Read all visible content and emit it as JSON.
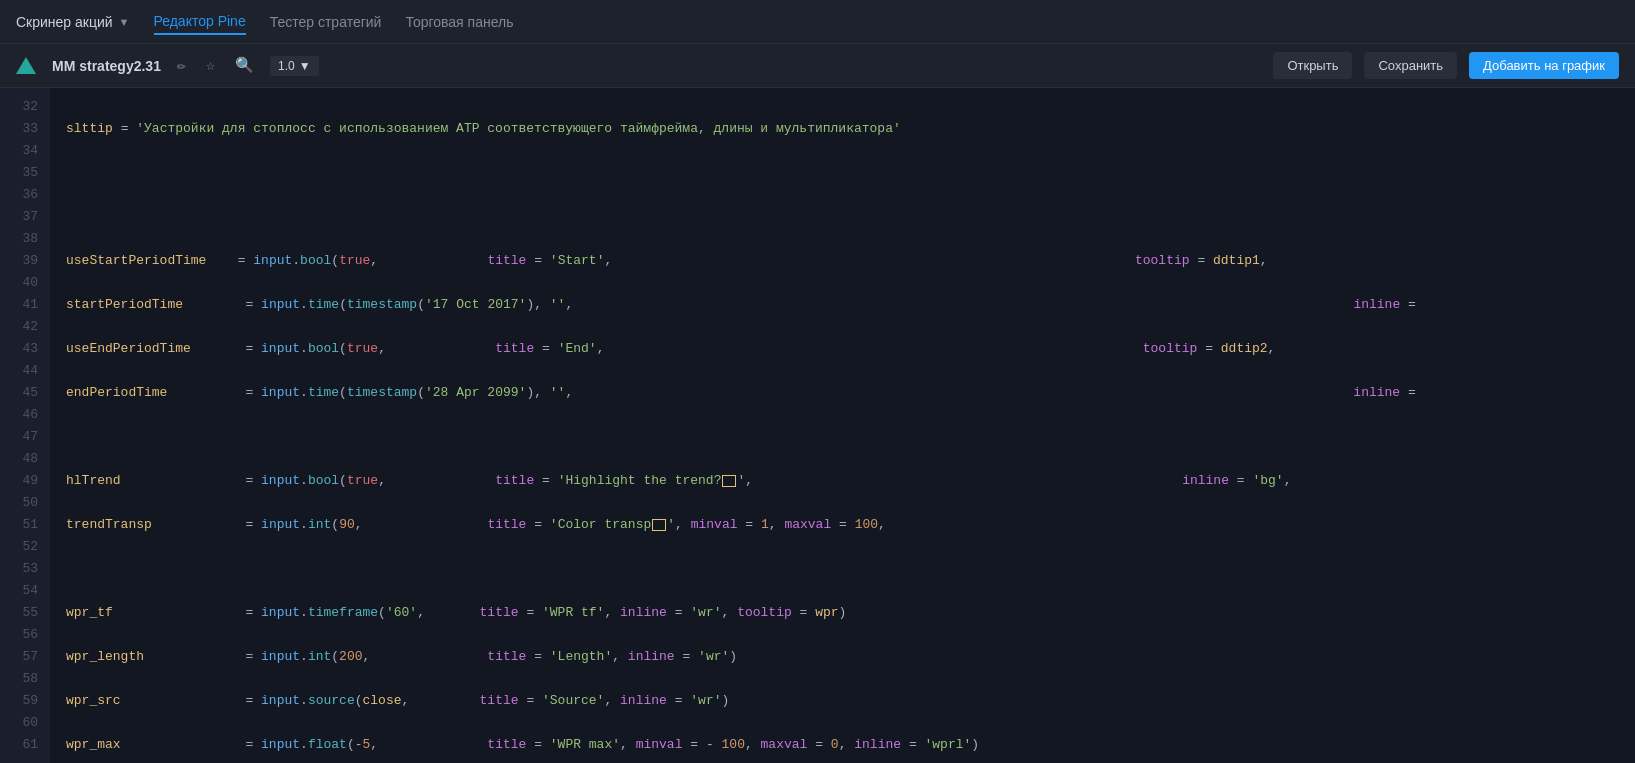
{
  "topNav": {
    "brand": "Скринер акций",
    "items": [
      {
        "label": "Скринер акций",
        "active": false
      },
      {
        "label": "Редактор Pine",
        "active": true
      },
      {
        "label": "Тестер стратегий",
        "active": false
      },
      {
        "label": "Торговая панель",
        "active": false
      }
    ]
  },
  "editorToolbar": {
    "scriptName": "MM strategy2.31",
    "version": "1.0",
    "buttons": {
      "open": "Открыть",
      "save": "Сохранить",
      "addToChart": "Добавить на график"
    }
  },
  "lineNumbers": [
    32,
    33,
    34,
    35,
    36,
    37,
    38,
    39,
    40,
    41,
    42,
    43,
    44,
    45,
    46,
    47,
    48,
    49,
    50,
    51,
    52,
    53,
    54,
    55,
    56,
    57,
    58,
    59,
    60,
    61
  ]
}
